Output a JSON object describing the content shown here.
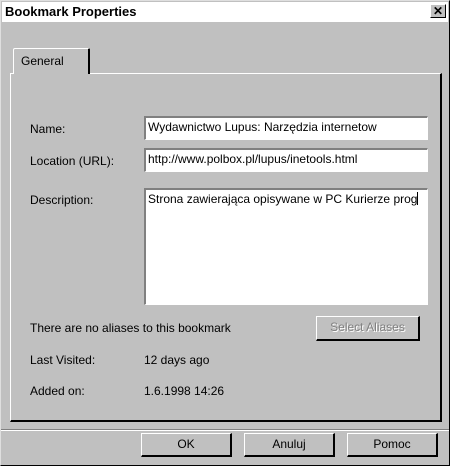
{
  "window": {
    "title": "Bookmark Properties",
    "close_glyph": "✕"
  },
  "tabs": [
    {
      "label": "General"
    }
  ],
  "form": {
    "name_label": "Name:",
    "name_value": "Wydawnictwo Lupus: Narzędzia internetow",
    "location_label": "Location (URL):",
    "location_value": "http://www.polbox.pl/lupus/inetools.html",
    "description_label": "Description:",
    "description_value": "Strona zawierająca opisywane w PC Kurierze prog",
    "aliases_text": "There are no aliases to this bookmark",
    "select_aliases_label": "Select Aliases",
    "last_visited_label": "Last Visited:",
    "last_visited_value": "12 days ago",
    "added_on_label": "Added on:",
    "added_on_value": "1.6.1998 14:26"
  },
  "buttons": {
    "ok": "OK",
    "cancel": "Anuluj",
    "help": "Pomoc"
  },
  "icons": {
    "close": "close-icon"
  }
}
